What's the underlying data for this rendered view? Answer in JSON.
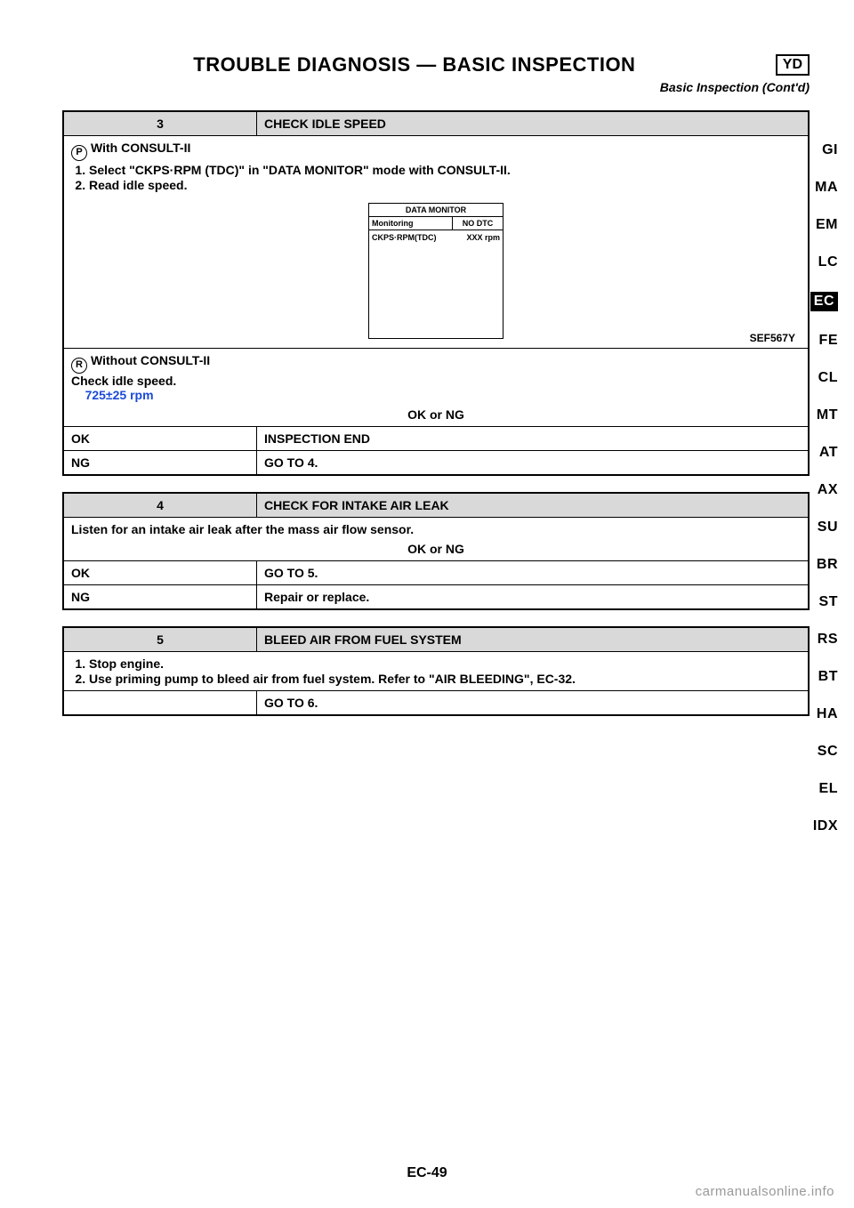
{
  "header": {
    "title": "TROUBLE DIAGNOSIS — BASIC INSPECTION",
    "badge": "YD",
    "subheader": "Basic Inspection (Cont'd)"
  },
  "sidebar": {
    "items": [
      {
        "label": "GI",
        "active": false
      },
      {
        "label": "MA",
        "active": false
      },
      {
        "label": "EM",
        "active": false
      },
      {
        "label": "LC",
        "active": false
      },
      {
        "label": "EC",
        "active": true
      },
      {
        "label": "FE",
        "active": false
      },
      {
        "label": "CL",
        "active": false
      },
      {
        "label": "MT",
        "active": false
      },
      {
        "label": "AT",
        "active": false
      },
      {
        "label": "AX",
        "active": false
      },
      {
        "label": "SU",
        "active": false
      },
      {
        "label": "BR",
        "active": false
      },
      {
        "label": "ST",
        "active": false
      },
      {
        "label": "RS",
        "active": false
      },
      {
        "label": "BT",
        "active": false
      },
      {
        "label": "HA",
        "active": false
      },
      {
        "label": "SC",
        "active": false
      },
      {
        "label": "EL",
        "active": false
      },
      {
        "label": "IDX",
        "active": false
      }
    ]
  },
  "consult_icon_glyph": "P",
  "without_icon_glyph": "R",
  "step3": {
    "num": "3",
    "title": "CHECK IDLE SPEED",
    "with_label": "With CONSULT-II",
    "bullets": [
      "Select \"CKPS·RPM (TDC)\" in \"DATA MONITOR\" mode with CONSULT-II.",
      "Read idle speed."
    ],
    "monitor": {
      "title": "DATA MONITOR",
      "left_label": "Monitoring",
      "right_label": "NO DTC",
      "param": "CKPS·RPM(TDC)",
      "value": "XXX rpm",
      "ref": "SEF567Y"
    },
    "without_label": "Without CONSULT-II",
    "without_body": "Check idle speed.",
    "spec": "725±25 rpm",
    "okng": "OK or NG",
    "rows": [
      {
        "result": "OK",
        "action": "INSPECTION END"
      },
      {
        "result": "NG",
        "action": "GO TO 4."
      }
    ]
  },
  "step4": {
    "num": "4",
    "title": "CHECK FOR INTAKE AIR LEAK",
    "body": "Listen for an intake air leak after the mass air flow sensor.",
    "okng": "OK or NG",
    "rows": [
      {
        "result": "OK",
        "action": "GO TO 5."
      },
      {
        "result": "NG",
        "action": "Repair or replace."
      }
    ]
  },
  "step5": {
    "num": "5",
    "title": "BLEED AIR FROM FUEL SYSTEM",
    "bullets": [
      "Stop engine.",
      "Use priming pump to bleed air from fuel system. Refer to \"AIR BLEEDING\", EC-32."
    ],
    "rows": [
      {
        "result": "",
        "action": "GO TO 6."
      }
    ]
  },
  "footer": {
    "pagenum": "EC-49",
    "watermark": "carmanualsonline.info"
  }
}
